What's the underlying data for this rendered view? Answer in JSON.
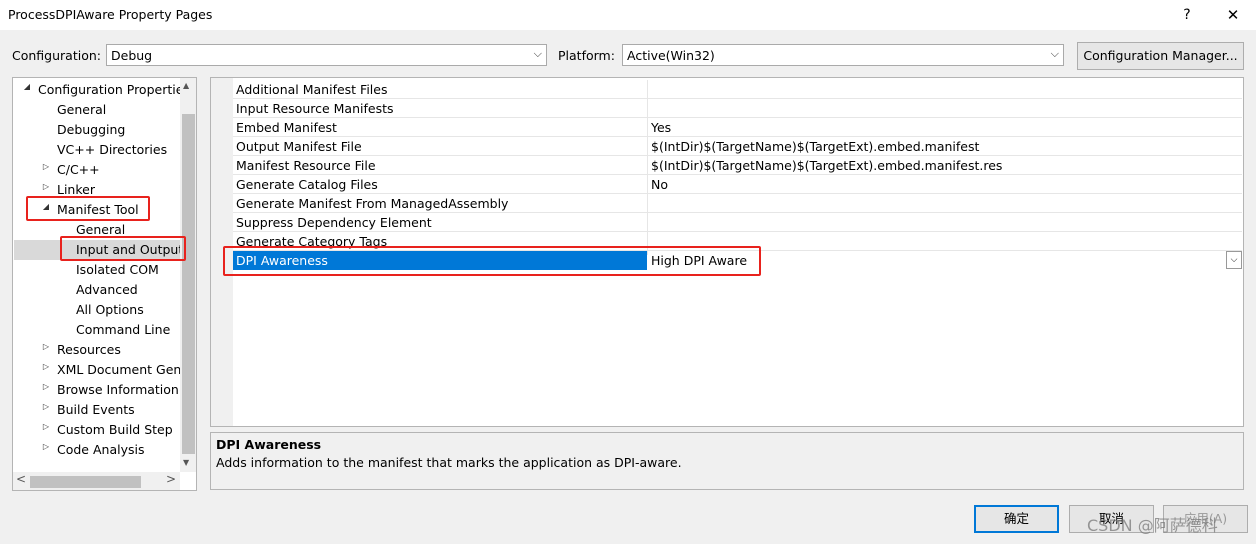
{
  "window": {
    "title": "ProcessDPIAware Property Pages",
    "help": "?",
    "close": "✕"
  },
  "config_bar": {
    "configuration_label": "Configuration:",
    "configuration_value": "Debug",
    "platform_label": "Platform:",
    "platform_value": "Active(Win32)",
    "manager_button": "Configuration Manager..."
  },
  "tree": {
    "items": [
      {
        "label": "Configuration Properties",
        "toggle": "◢"
      },
      {
        "label": "General"
      },
      {
        "label": "Debugging"
      },
      {
        "label": "VC++ Directories"
      },
      {
        "label": "C/C++",
        "toggle": "▷"
      },
      {
        "label": "Linker",
        "toggle": "▷"
      },
      {
        "label": "Manifest Tool",
        "toggle": "◢"
      },
      {
        "label": "General"
      },
      {
        "label": "Input and Output"
      },
      {
        "label": "Isolated COM"
      },
      {
        "label": "Advanced"
      },
      {
        "label": "All Options"
      },
      {
        "label": "Command Line"
      },
      {
        "label": "Resources",
        "toggle": "▷"
      },
      {
        "label": "XML Document Generator",
        "toggle": "▷"
      },
      {
        "label": "Browse Information",
        "toggle": "▷"
      },
      {
        "label": "Build Events",
        "toggle": "▷"
      },
      {
        "label": "Custom Build Step",
        "toggle": "▷"
      },
      {
        "label": "Code Analysis",
        "toggle": "▷"
      }
    ],
    "scroll_left": "<",
    "scroll_right": ">"
  },
  "properties": [
    {
      "name": "Additional Manifest Files",
      "value": ""
    },
    {
      "name": "Input Resource Manifests",
      "value": ""
    },
    {
      "name": "Embed Manifest",
      "value": "Yes"
    },
    {
      "name": "Output Manifest File",
      "value": "$(IntDir)$(TargetName)$(TargetExt).embed.manifest"
    },
    {
      "name": "Manifest Resource File",
      "value": "$(IntDir)$(TargetName)$(TargetExt).embed.manifest.res"
    },
    {
      "name": "Generate Catalog Files",
      "value": "No"
    },
    {
      "name": "Generate Manifest From ManagedAssembly",
      "value": ""
    },
    {
      "name": "Suppress Dependency Element",
      "value": ""
    },
    {
      "name": "Generate Category Tags",
      "value": ""
    },
    {
      "name": "DPI Awareness",
      "value": "High DPI Aware"
    }
  ],
  "description": {
    "title": "DPI Awareness",
    "text": "Adds information to the manifest that marks the application as DPI-aware."
  },
  "buttons": {
    "ok": "确定",
    "cancel": "取消",
    "apply": "应用(A)"
  },
  "watermark": "CSDN @阿萨德科",
  "colors": {
    "selection": "#0078d7",
    "highlight_box": "#e8221d"
  }
}
